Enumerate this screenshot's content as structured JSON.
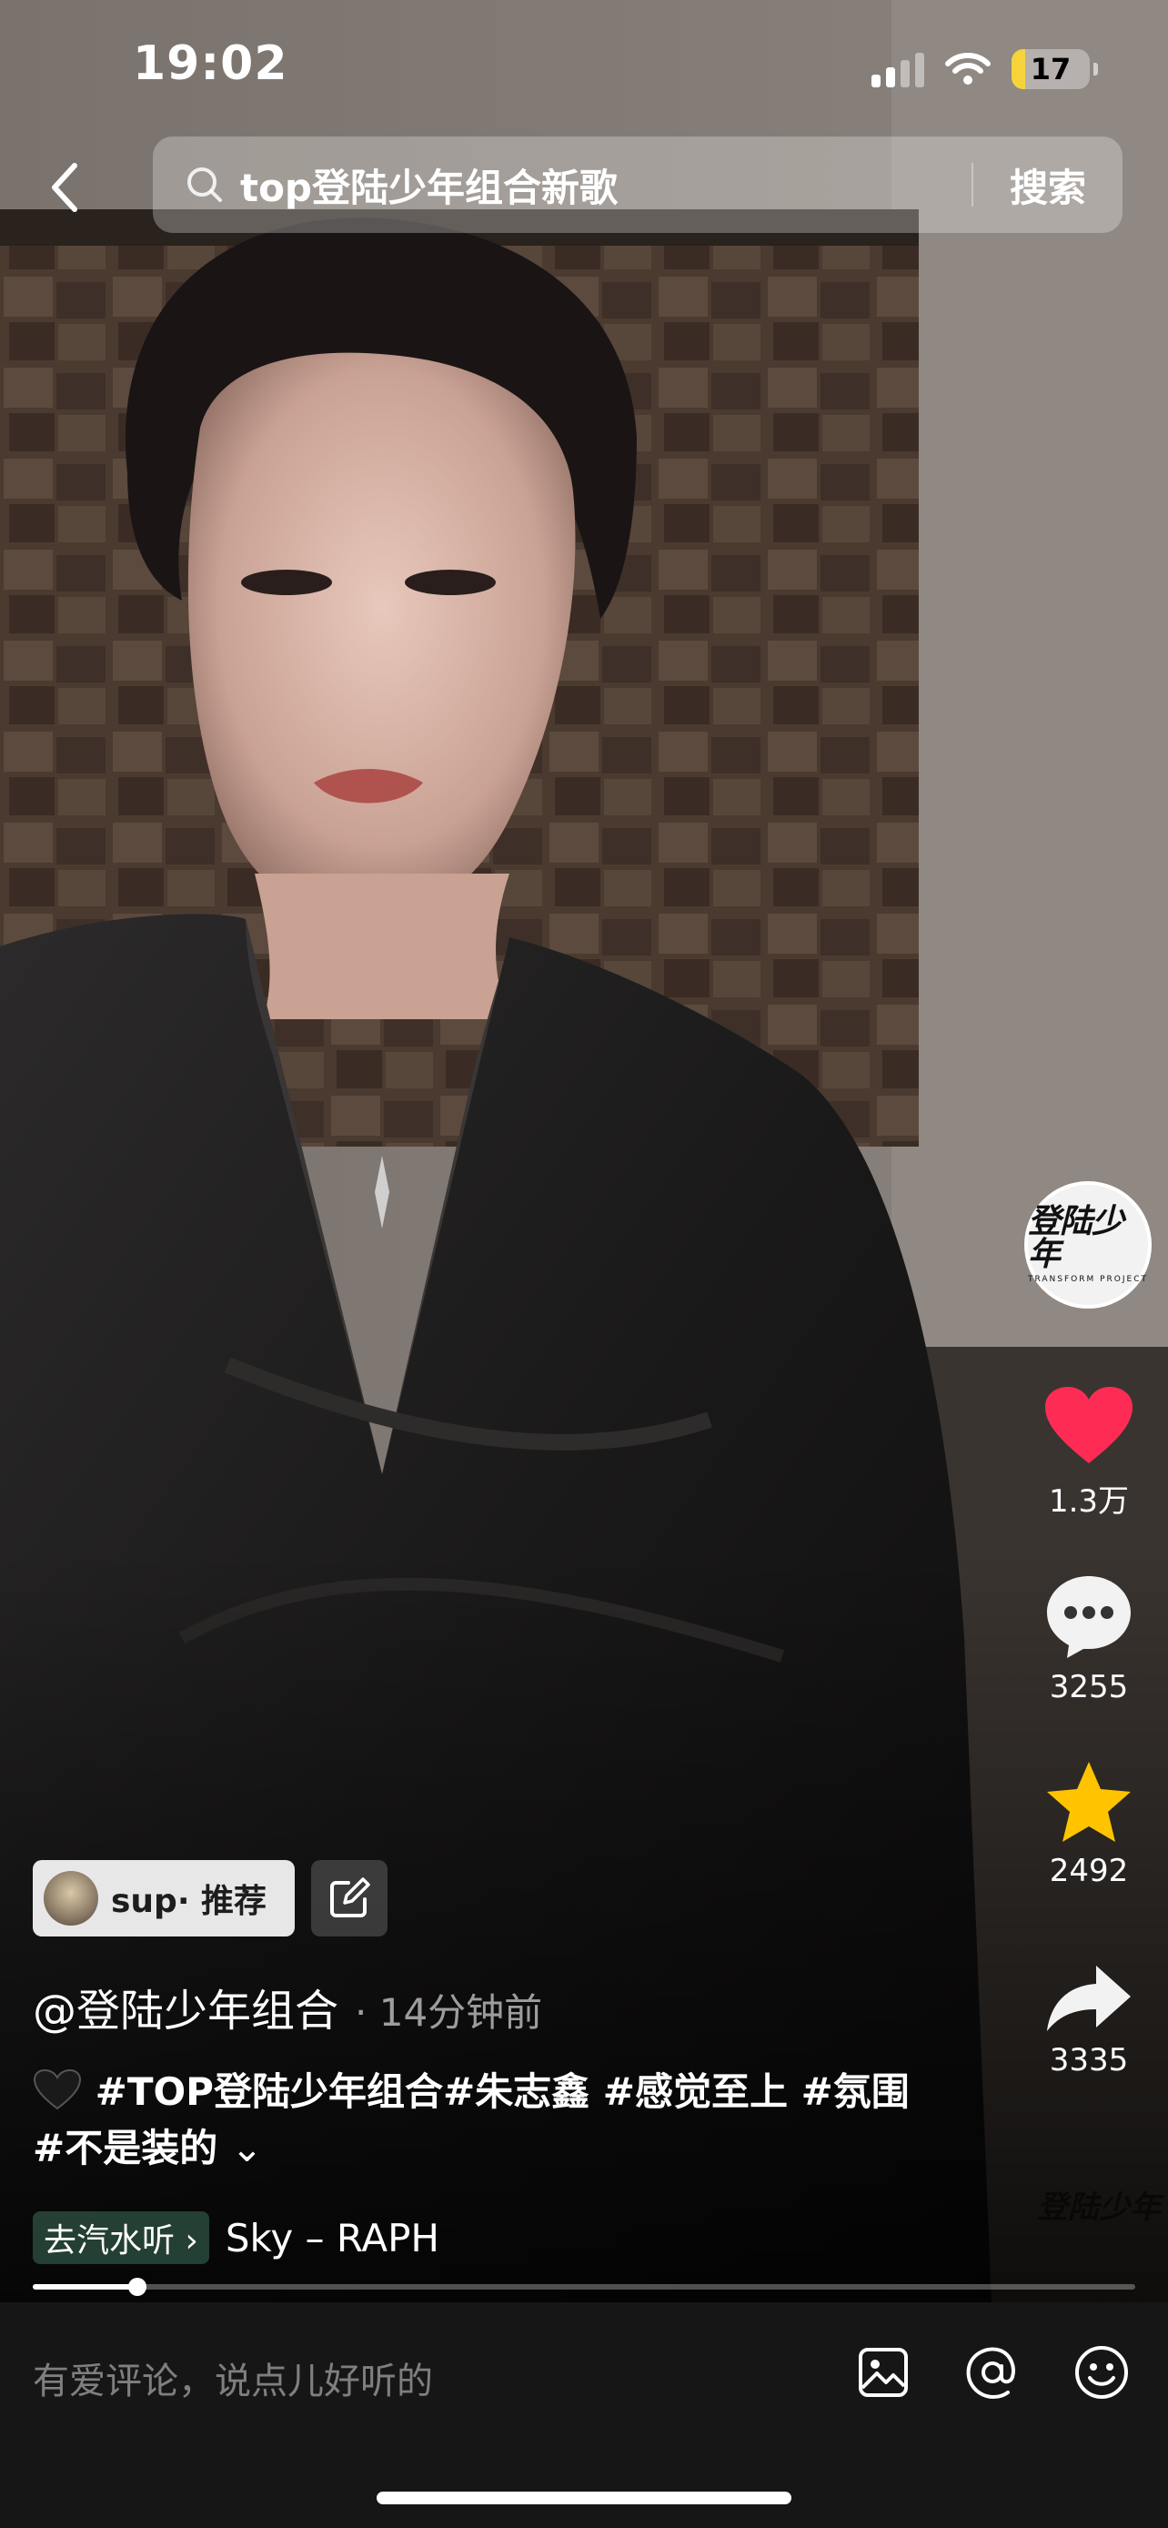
{
  "status_bar": {
    "time": "19:02",
    "battery_level": "17",
    "battery_fraction": 0.17
  },
  "search": {
    "query": "top登陆少年组合新歌",
    "submit_label": "搜索"
  },
  "creator_logo": {
    "main": "登陆少年",
    "sub": "TRANSFORM PROJECT"
  },
  "actions": {
    "likes": "1.3万",
    "comments": "3255",
    "favorites": "2492",
    "shares": "3335"
  },
  "watermark": "登陆少年",
  "recommend": {
    "label": "sup· 推荐"
  },
  "post": {
    "author": "@登陆少年组合",
    "time_ago": "· 14分钟前",
    "description": "#TOP登陆少年组合#朱志鑫 #感觉至上 #氛围 #不是装的",
    "expand_glyph": "⌄"
  },
  "music": {
    "chip_label": "去汽水听 ›",
    "title": "Sky – RAPH"
  },
  "playback": {
    "progress_fraction": 0.095
  },
  "comment_bar": {
    "placeholder": "有爱评论，说点儿好听的"
  },
  "colors": {
    "like": "#fe2c55",
    "favorite": "#ffc300",
    "battery": "#f6d33a"
  },
  "icons": [
    "back-icon",
    "search-icon",
    "heart-icon",
    "comment-icon",
    "star-icon",
    "share-icon",
    "edit-icon",
    "image-icon",
    "mention-icon",
    "emoji-icon"
  ]
}
